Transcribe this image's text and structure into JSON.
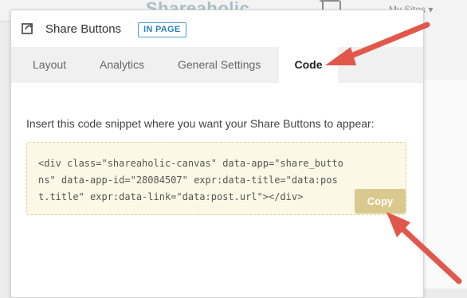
{
  "background": {
    "logo_text": "Shareaholic",
    "my_sites": "My Sites ▾"
  },
  "modal": {
    "title": "Share Buttons",
    "badge": "IN PAGE",
    "tabs": [
      {
        "label": "Layout",
        "active": false
      },
      {
        "label": "Analytics",
        "active": false
      },
      {
        "label": "General Settings",
        "active": false
      },
      {
        "label": "Code",
        "active": true
      }
    ],
    "instruction": "Insert this code snippet where you want your Share Buttons to appear:",
    "code_lines": [
      "<div class=\"shareaholic-canvas\" data-app=\"share_butto",
      "ns\" data-app-id=\"28084507\" expr:data-title=\"data:pos",
      "t.title\" expr:data-link=\"data:post.url\"></div>"
    ],
    "copy_label": "Copy"
  },
  "colors": {
    "arrow": "#e2574c",
    "code_background": "#fdf8e6",
    "copy_button": "#dac98f",
    "badge": "#2c7fb8"
  }
}
